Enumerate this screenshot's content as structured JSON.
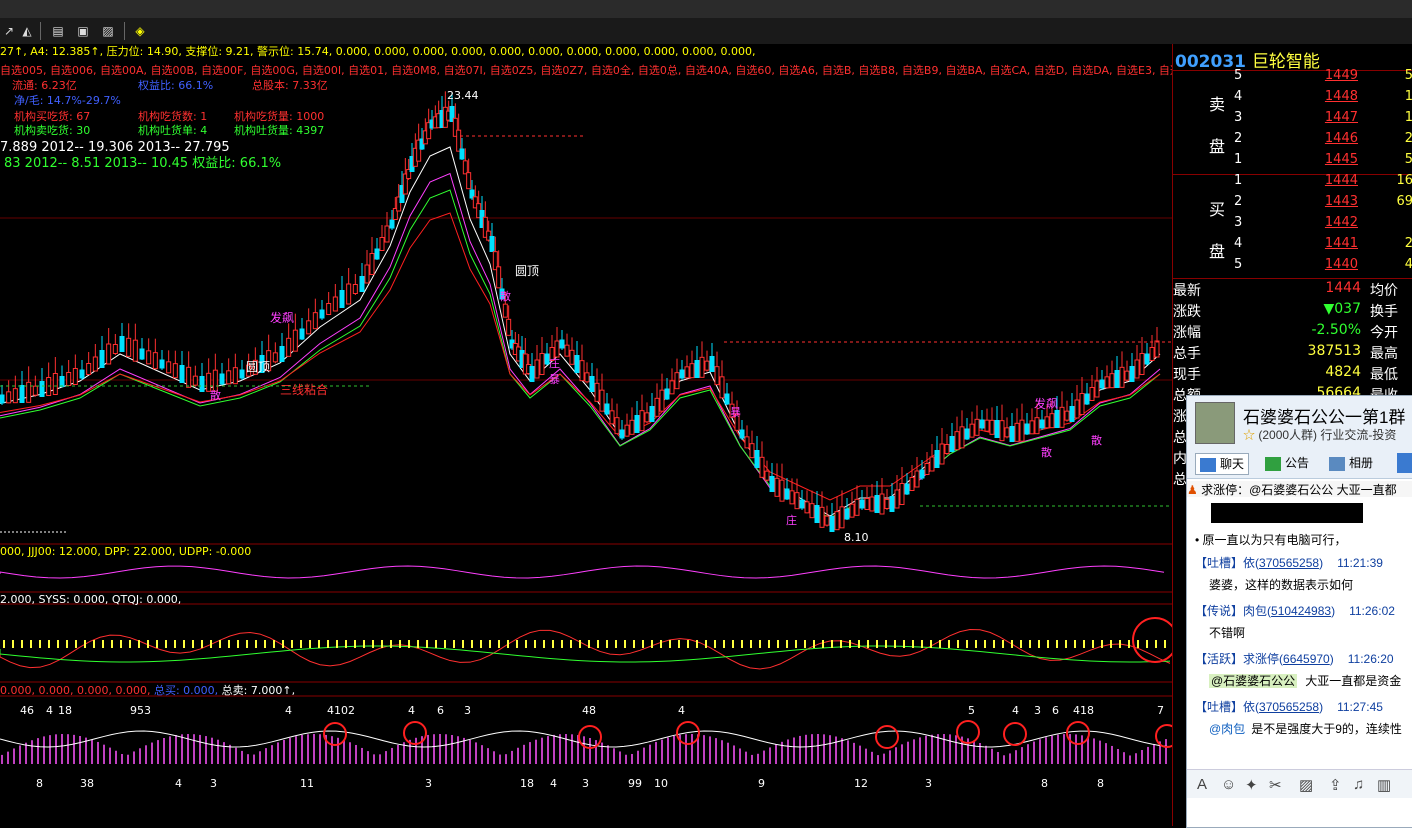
{
  "toolbar": {
    "icons": [
      "draw-icon",
      "fib-icon",
      "notes-icon",
      "chat-icon",
      "picture-icon",
      "diamond-icon"
    ]
  },
  "chart": {
    "ind_line1": "27↑, A4: 12.385↑, 压力位: 14.90, 支撑位: 9.21, 警示位: 15.74, 0.000, 0.000, 0.000, 0.000, 0.000, 0.000, 0.000, 0.000, 0.000, 0.000, 0.000,",
    "ind_line2": "自选005, 自选006, 自选00A, 自选00B, 自选00F, 自选00G, 自选00I, 自选01, 自选0M8, 自选07I, 自选0Z5, 自选0Z7, 自选0全, 自选0总, 自选40A, 自选60, 自选A6, 自选B, 自选B8, 自选B9, 自选BA, 自选CA, 自选D, 自选DA, 自选E3, 自选E7, 自",
    "flow": "流通: 6.23亿",
    "equity_ratio": "权益比: 66.1%",
    "total_shares": "总股本: 7.33亿",
    "margin": "净/毛: 14.7%-29.7%",
    "inst1": "机构买吃货: 67",
    "inst2": "机构吃货数: 1",
    "inst3": "机构吃货量: 1000",
    "inst4": "机构卖吃货: 30",
    "inst5": "机构吐货单: 4",
    "inst6": "机构吐货量: 4397",
    "yr1": "7.889    2012-- 19.306    2013-- 27.795",
    "yr2": "83    2012-- 8.51    2013-- 10.45    权益比: 66.1%",
    "high_label": "23.44",
    "low_label": "8.10",
    "yuanding": "圆顶",
    "fapiao": "发飙",
    "sanxian": "三线粘合",
    "san": "散",
    "zhuang": "庄",
    "bao": "暴",
    "sub1": "000, JJJ00: 12.000, DPP: 22.000, UDPP: -0.000",
    "sub2": "2.000, SYSS: 0.000, QTQJ: 0.000,",
    "sub3": "0.000, 0.000, 0.000, 0.000,",
    "sub3_buy": "总买: 0.000,",
    "sub3_sell": "总卖: 7.000↑,",
    "bottom_nums": [
      "8",
      "38",
      "4",
      "3",
      "11",
      "3",
      "18",
      "4",
      "3",
      "99",
      "10",
      "9",
      "12",
      "3",
      "8",
      "8"
    ],
    "top_nums": [
      "46",
      "4",
      "18",
      "953",
      "4",
      "4102",
      "4",
      "6",
      "3",
      "48",
      "4",
      "5",
      "4",
      "3",
      "6",
      "418",
      "7"
    ],
    "mark_14": "14"
  },
  "stock": {
    "code": "002031",
    "name": "巨轮智能"
  },
  "sell": [
    {
      "lv": "5",
      "price": "1449",
      "vol": "5"
    },
    {
      "lv": "4",
      "price": "1448",
      "vol": "1"
    },
    {
      "lv": "3",
      "price": "1447",
      "vol": "1"
    },
    {
      "lv": "2",
      "price": "1446",
      "vol": "2"
    },
    {
      "lv": "1",
      "price": "1445",
      "vol": "5"
    }
  ],
  "buy": [
    {
      "lv": "1",
      "price": "1444",
      "vol": "16"
    },
    {
      "lv": "2",
      "price": "1443",
      "vol": "69"
    },
    {
      "lv": "3",
      "price": "1442",
      "vol": ""
    },
    {
      "lv": "4",
      "price": "1441",
      "vol": "2"
    },
    {
      "lv": "5",
      "price": "1440",
      "vol": "4"
    }
  ],
  "sell_label_1": "卖",
  "sell_label_2": "盘",
  "buy_label_1": "买",
  "buy_label_2": "盘",
  "stats": [
    {
      "k": "最新",
      "v": "1444",
      "c": "#ff3030",
      "k2": "均价"
    },
    {
      "k": "涨跌",
      "v": "▼037",
      "c": "#30ff30",
      "k2": "换手"
    },
    {
      "k": "涨幅",
      "v": "-2.50%",
      "c": "#30ff30",
      "k2": "今开"
    },
    {
      "k": "总手",
      "v": "387513",
      "c": "#ffff40",
      "k2": "最高"
    },
    {
      "k": "现手",
      "v": "4824",
      "c": "#ffff40",
      "k2": "最低"
    },
    {
      "k": "总额",
      "v": "56664",
      "c": "#ffff40",
      "k2": "最收"
    }
  ],
  "side_partial": [
    "涨",
    "总",
    "内",
    "总"
  ],
  "chat": {
    "group_name": "石婆婆石公公一第1群",
    "group_sub": "(2000人群) 行业交流-投资",
    "tabs": [
      "聊天",
      "公告",
      "相册"
    ],
    "top_msg": "求涨停：@石婆婆石公公  大亚一直都",
    "line0": "• 原一直以为只有电脑可行，",
    "msgs": [
      {
        "tag": "【吐槽】依",
        "uid": "370565258",
        "time": "11:21:39",
        "text": "婆婆，这样的数据表示如何"
      },
      {
        "tag": "【传说】肉包",
        "uid": "510424983",
        "time": "11:26:02",
        "text": "不错啊"
      },
      {
        "tag": "【活跃】求涨停",
        "uid": "6645970",
        "time": "11:26:20",
        "text": "大亚一直都是资金"
      },
      {
        "tag": "【吐槽】依",
        "uid": "370565258",
        "time": "11:27:45",
        "text": "是不是强度大于9的，连续性"
      }
    ],
    "mention1": "@石婆婆石公公",
    "mention2": "@肉包"
  }
}
